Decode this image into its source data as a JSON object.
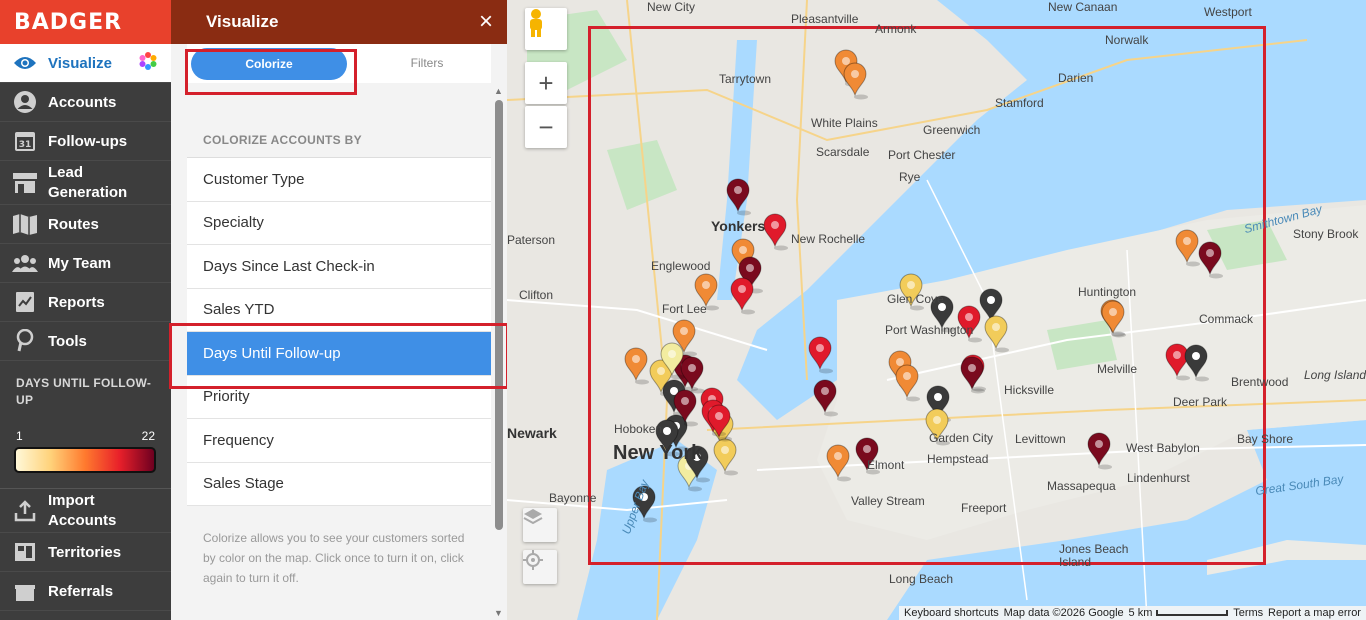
{
  "nav": {
    "brand": "BADGER",
    "items": [
      {
        "label": "Visualize",
        "icon": "eye-icon",
        "active": true
      },
      {
        "label": "Accounts",
        "icon": "user-circle-icon"
      },
      {
        "label": "Follow-ups",
        "icon": "calendar-icon",
        "day": "31"
      },
      {
        "label1": "Lead",
        "label2": "Generation",
        "icon": "storefront-icon"
      },
      {
        "label": "Routes",
        "icon": "map-icon"
      },
      {
        "label": "My Team",
        "icon": "team-icon"
      },
      {
        "label": "Reports",
        "icon": "report-icon"
      },
      {
        "label": "Tools",
        "icon": "tools-icon"
      }
    ],
    "legend": {
      "title": "DAYS UNTIL FOLLOW-UP",
      "min": "1",
      "max": "22",
      "colors": [
        "#fff8d8",
        "#ffd27a",
        "#ff7a2e",
        "#e8202a",
        "#6e0020"
      ]
    },
    "bottom_items": [
      {
        "label1": "Import",
        "label2": "Accounts",
        "icon": "upload-icon"
      },
      {
        "label": "Territories",
        "icon": "territory-icon"
      },
      {
        "label": "Referrals",
        "icon": "gift-icon"
      }
    ]
  },
  "panel": {
    "title": "Visualize",
    "close": "×",
    "tabs": {
      "colorize": "Colorize",
      "filters": "Filters"
    },
    "list_header": "COLORIZE ACCOUNTS BY",
    "options": [
      "Customer Type",
      "Specialty",
      "Days Since Last Check-in",
      "Sales YTD",
      "Days Until Follow-up",
      "Priority",
      "Frequency",
      "Sales Stage"
    ],
    "selected_option": "Days Until Follow-up",
    "note": "Colorize allows you to see your customers sorted by color on the map. Click once to turn it on, click again to turn it off."
  },
  "map": {
    "labels": [
      {
        "t": "New City",
        "big": false
      },
      {
        "t": "Pleasantville"
      },
      {
        "t": "New Canaan"
      },
      {
        "t": "Westport"
      },
      {
        "t": "Armonk"
      },
      {
        "t": "Norwalk"
      },
      {
        "t": "Tarrytown"
      },
      {
        "t": "Darien"
      },
      {
        "t": "Stamford"
      },
      {
        "t": "White Plains"
      },
      {
        "t": "Greenwich"
      },
      {
        "t": "Scarsdale"
      },
      {
        "t": "Port Chester"
      },
      {
        "t": "Rye"
      },
      {
        "t": "Paterson"
      },
      {
        "t": "Yonkers"
      },
      {
        "t": "New Rochelle"
      },
      {
        "t": "Englewood"
      },
      {
        "t": "Clifton"
      },
      {
        "t": "Fort Lee"
      },
      {
        "t": "Glen Cove"
      },
      {
        "t": "Port Washington"
      },
      {
        "t": "Huntington"
      },
      {
        "t": "Commack"
      },
      {
        "t": "Stony Brook"
      },
      {
        "t": "Smithtown Bay"
      },
      {
        "t": "Melville"
      },
      {
        "t": "Hicksville"
      },
      {
        "t": "Hoboken"
      },
      {
        "t": "Newark"
      },
      {
        "t": "New York"
      },
      {
        "t": "Deer Park"
      },
      {
        "t": "Brentwood"
      },
      {
        "t": "Long Island"
      },
      {
        "t": "Garden City"
      },
      {
        "t": "Levittown"
      },
      {
        "t": "West Babylon"
      },
      {
        "t": "Bay Shore"
      },
      {
        "t": "Hempstead"
      },
      {
        "t": "Elmont"
      },
      {
        "t": "Massapequa"
      },
      {
        "t": "Lindenhurst"
      },
      {
        "t": "Great South Bay"
      },
      {
        "t": "Bayonne"
      },
      {
        "t": "Upper Bay"
      },
      {
        "t": "Valley Stream"
      },
      {
        "t": "Freeport"
      },
      {
        "t": "Jones Beach Island"
      },
      {
        "t": "Long Beach"
      }
    ],
    "footer": {
      "shortcuts": "Keyboard shortcuts",
      "mapdata": "Map data ©2026 Google",
      "scale": "5 km",
      "terms": "Terms",
      "report": "Report a map error"
    },
    "pin_colors": {
      "black": "#3a3a3a",
      "maroon": "#7a0a1e",
      "red": "#e01a2b",
      "orange": "#f08a35",
      "yellow": "#f2cc5a",
      "pale": "#f2eca0"
    },
    "pins": [
      {
        "c": "orange"
      },
      {
        "c": "orange"
      },
      {
        "c": "maroon"
      },
      {
        "c": "red"
      },
      {
        "c": "orange"
      },
      {
        "c": "orange"
      },
      {
        "c": "maroon"
      },
      {
        "c": "red"
      },
      {
        "c": "orange"
      },
      {
        "c": "maroon"
      },
      {
        "c": "yellow"
      },
      {
        "c": "pale"
      },
      {
        "c": "black"
      },
      {
        "c": "red"
      },
      {
        "c": "black"
      },
      {
        "c": "pale"
      },
      {
        "c": "orange"
      },
      {
        "c": "maroon"
      },
      {
        "c": "orange"
      },
      {
        "c": "red"
      },
      {
        "c": "black"
      },
      {
        "c": "orange"
      },
      {
        "c": "orange"
      },
      {
        "c": "orange"
      },
      {
        "c": "maroon"
      },
      {
        "c": "yellow"
      },
      {
        "c": "yellow"
      },
      {
        "c": "red"
      },
      {
        "c": "maroon"
      },
      {
        "c": "red"
      },
      {
        "c": "maroon"
      },
      {
        "c": "red"
      },
      {
        "c": "black"
      },
      {
        "c": "red"
      },
      {
        "c": "black"
      },
      {
        "c": "black"
      },
      {
        "c": "yellow"
      },
      {
        "c": "yellow"
      },
      {
        "c": "black"
      },
      {
        "c": "orange"
      },
      {
        "c": "maroon"
      },
      {
        "c": "maroon"
      },
      {
        "c": "red"
      },
      {
        "c": "orange"
      },
      {
        "c": "black"
      },
      {
        "c": "yellow"
      },
      {
        "c": "maroon"
      },
      {
        "c": "black"
      }
    ]
  }
}
